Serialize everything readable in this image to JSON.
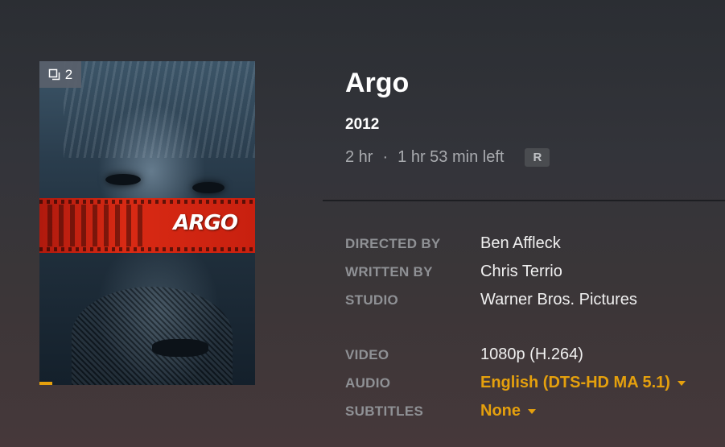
{
  "movie": {
    "title": "Argo",
    "year": "2012",
    "duration": "2 hr",
    "separator": "·",
    "time_left": "1 hr 53 min left",
    "content_rating": "R"
  },
  "poster": {
    "stack_count": "2",
    "poster_title": "ARGO",
    "watch_progress": 0.06,
    "progress_color": "#e5a00d"
  },
  "credits": [
    {
      "label": "DIRECTED BY",
      "value": "Ben Affleck"
    },
    {
      "label": "WRITTEN BY",
      "value": "Chris Terrio"
    },
    {
      "label": "STUDIO",
      "value": "Warner Bros. Pictures"
    }
  ],
  "media": {
    "video": {
      "label": "VIDEO",
      "value": "1080p (H.264)"
    },
    "audio": {
      "label": "AUDIO",
      "value": "English (DTS-HD MA 5.1)"
    },
    "subtitles": {
      "label": "SUBTITLES",
      "value": "None"
    }
  },
  "colors": {
    "accent": "#e5a00d",
    "label": "#8f9195",
    "meta": "#a9abaf"
  }
}
